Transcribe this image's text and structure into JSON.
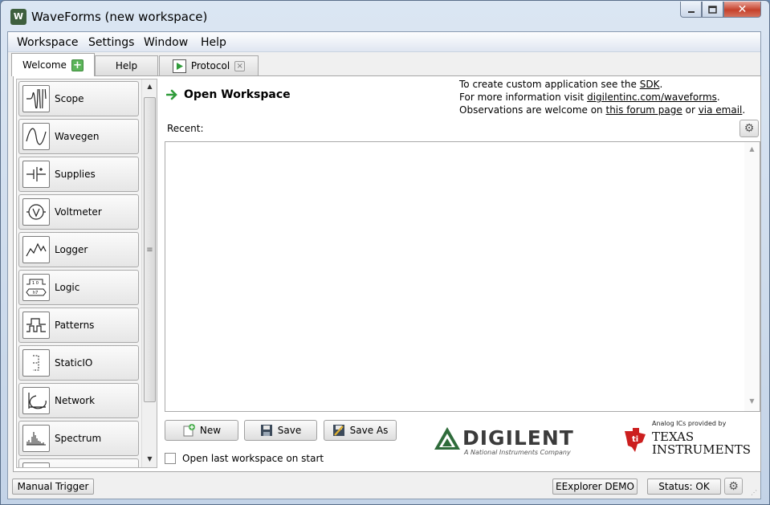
{
  "window": {
    "title": "WaveForms  (new workspace)",
    "app_icon_text": "W",
    "minimize_icon": "minimize-icon",
    "maximize_icon": "maximize-icon",
    "close_icon": "close-icon",
    "close_glyph": "✕"
  },
  "menu": {
    "items": [
      "Workspace",
      "Settings",
      "Window",
      "Help"
    ]
  },
  "tabs": [
    {
      "label": "Welcome",
      "icon": "plus-icon"
    },
    {
      "label": "Help"
    },
    {
      "label": "Protocol",
      "icon": "play-icon",
      "close": "×"
    }
  ],
  "sidebar": {
    "items": [
      {
        "label": "Scope",
        "icon": "scope-icon"
      },
      {
        "label": "Wavegen",
        "icon": "wavegen-icon"
      },
      {
        "label": "Supplies",
        "icon": "supplies-icon"
      },
      {
        "label": "Voltmeter",
        "icon": "voltmeter-icon"
      },
      {
        "label": "Logger",
        "icon": "logger-icon"
      },
      {
        "label": "Logic",
        "icon": "logic-icon"
      },
      {
        "label": "Patterns",
        "icon": "patterns-icon"
      },
      {
        "label": "StaticIO",
        "icon": "staticio-icon"
      },
      {
        "label": "Network",
        "icon": "network-icon"
      },
      {
        "label": "Spectrum",
        "icon": "spectrum-icon"
      }
    ]
  },
  "main": {
    "open_workspace": "Open Workspace",
    "recent_label": "Recent:",
    "info_line1_prefix": "To create custom application see the ",
    "info_line1_link": "SDK",
    "info_line1_suffix": ".",
    "info_line2_prefix": "For more information visit ",
    "info_line2_link": "digilentinc.com/waveforms",
    "info_line2_suffix": ".",
    "info_line3_prefix": "Observations are welcome on ",
    "info_line3_link1": "this forum page",
    "info_line3_mid": " or ",
    "info_line3_link2": "via email",
    "info_line3_suffix": ".",
    "new_label": "New",
    "save_label": "Save",
    "save_as_label": "Save As",
    "open_last_label": "Open last workspace on start",
    "open_last_checked": false
  },
  "logos": {
    "digilent": "DIGILENT",
    "digilent_sub": "A National Instruments Company",
    "ti_top": "Analog ICs provided by",
    "ti_line1": "TEXAS",
    "ti_line2": "INSTRUMENTS"
  },
  "statusbar": {
    "manual_trigger": "Manual Trigger",
    "device": "EExplorer DEMO",
    "status": "Status: OK"
  },
  "colors": {
    "digilent_green": "#2e6b3a",
    "ti_red": "#cc1f1f",
    "arrow_green": "#2f9b3a"
  }
}
